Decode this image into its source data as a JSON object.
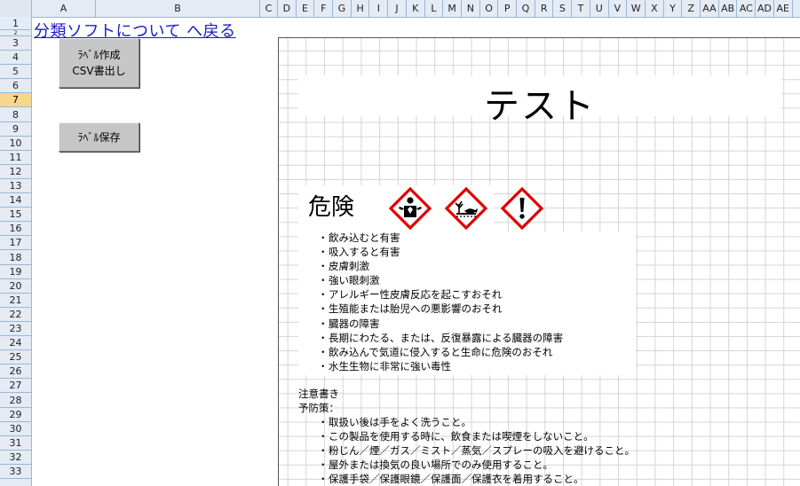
{
  "columns": [
    "A",
    "B",
    "C",
    "D",
    "E",
    "F",
    "G",
    "H",
    "I",
    "J",
    "K",
    "L",
    "M",
    "N",
    "O",
    "P",
    "Q",
    "R",
    "S",
    "T",
    "U",
    "V",
    "W",
    "X",
    "Y",
    "Z",
    "AA",
    "AB",
    "AC",
    "AD",
    "AE"
  ],
  "rows": [
    "1",
    "2",
    "3",
    "4",
    "5",
    "6",
    "7",
    "8",
    "9",
    "10",
    "11",
    "12",
    "13",
    "14",
    "15",
    "16",
    "17",
    "18",
    "19",
    "20",
    "21",
    "22",
    "23",
    "24",
    "25",
    "26",
    "27",
    "28",
    "29",
    "30",
    "31",
    "32",
    "33"
  ],
  "selected_row": "7",
  "link_about": "分類ソフトについて へ戻る",
  "buttons": {
    "create_line1": "ﾗﾍﾞﾙ作成",
    "create_line2": "CSV書出し",
    "save": "ﾗﾍﾞﾙ保存"
  },
  "label": {
    "title": "テスト",
    "signal_word": "危険",
    "pictograms": [
      {
        "icon": "health-hazard-icon",
        "color": "#e00000"
      },
      {
        "icon": "environment-icon",
        "color": "#e00000"
      },
      {
        "icon": "exclamation-mark-icon",
        "color": "#e00000"
      }
    ],
    "bullet": "・",
    "hazards": [
      "飲み込むと有害",
      "吸入すると有害",
      "皮膚刺激",
      "強い眼刺激",
      "アレルギー性皮膚反応を起こすおそれ",
      "生殖能または胎児への悪影響のおそれ",
      "臓器の障害",
      "長期にわたる、または、反復暴露による臓器の障害",
      "飲み込んで気道に侵入すると生命に危険のおそれ",
      "水生生物に非常に強い毒性"
    ],
    "notes_title": "注意書き",
    "prevention_title": "予防策：",
    "precautions": [
      "取扱い後は手をよく洗うこと。",
      "この製品を使用する時に、飲食または喫煙をしないこと。",
      "粉じん／煙／ガス／ミスト／蒸気／スプレーの吸入を避けること。",
      "屋外または換気の良い場所でのみ使用すること。",
      "保護手袋／保護眼鏡／保護面／保護衣を着用すること。"
    ]
  }
}
